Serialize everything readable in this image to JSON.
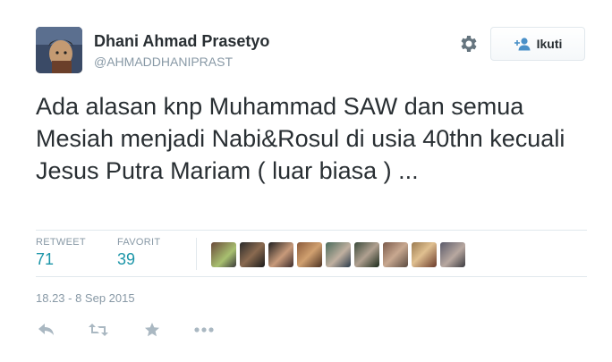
{
  "user": {
    "name": "Dhani Ahmad Prasetyo",
    "handle": "@AHMADDHANIPRAST"
  },
  "follow_button": {
    "label": "Ikuti",
    "icon": "add-user-icon"
  },
  "settings": {
    "icon": "gear-icon"
  },
  "tweet": {
    "text": "Ada alasan knp Muhammad SAW dan semua Mesiah menjadi Nabi&Rosul di usia 40thn kecuali Jesus Putra Mariam ( luar biasa ) ..."
  },
  "stats": {
    "retweet_label": "RETWEET",
    "retweet_count": "71",
    "favorite_label": "FAVORIT",
    "favorite_count": "39"
  },
  "favoriters_count_shown": 9,
  "timestamp": "18.23 - 8 Sep 2015",
  "actions": [
    "reply-icon",
    "retweet-icon",
    "favorite-icon",
    "more-icon"
  ],
  "colors": {
    "text": "#292f33",
    "muted": "#8899a6",
    "stat_value": "#1b95a8",
    "divider": "#e1e8ed"
  }
}
